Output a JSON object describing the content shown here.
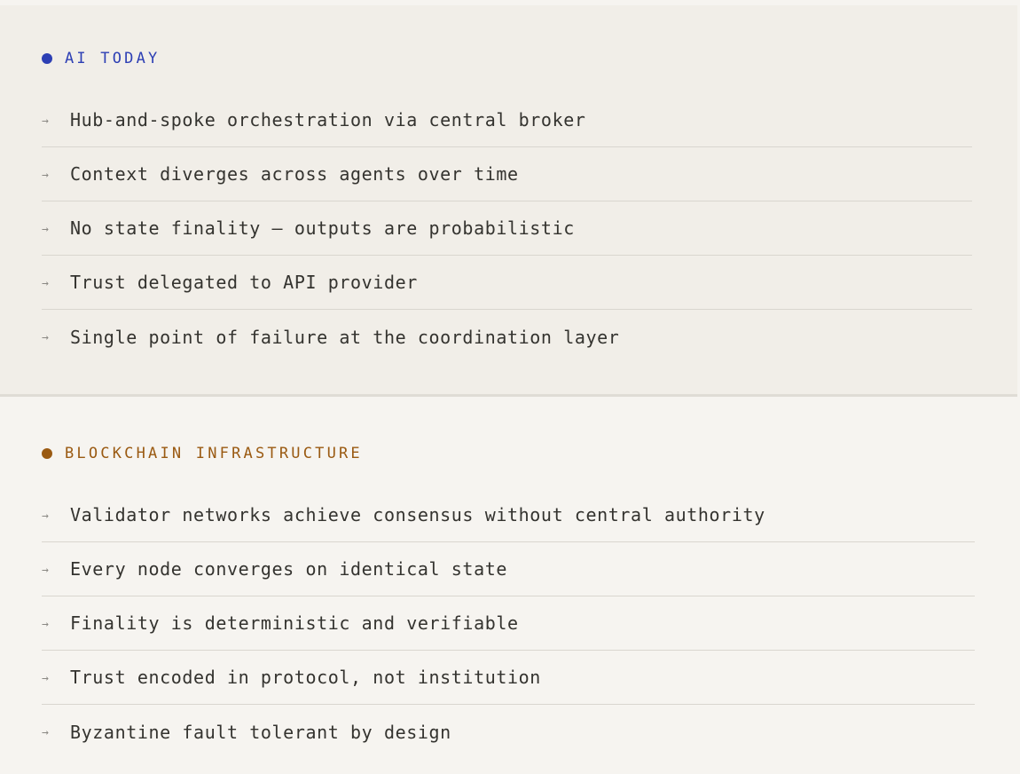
{
  "sections": {
    "ai": {
      "label": "AI TODAY",
      "accent": "#2d3fb4",
      "items": [
        "Hub-and-spoke orchestration via central broker",
        "Context diverges across agents over time",
        "No state finality — outputs are probabilistic",
        "Trust delegated to API provider",
        "Single point of failure at the coordination layer"
      ]
    },
    "blockchain": {
      "label": "BLOCKCHAIN INFRASTRUCTURE",
      "accent": "#9a5a12",
      "items": [
        "Validator networks achieve consensus without central authority",
        "Every node converges on identical state",
        "Finality is deterministic and verifiable",
        "Trust encoded in protocol, not institution",
        "Byzantine fault tolerant by design"
      ]
    }
  },
  "icons": {
    "bullet": "dot-icon",
    "item_marker": "arrow-right-icon"
  }
}
